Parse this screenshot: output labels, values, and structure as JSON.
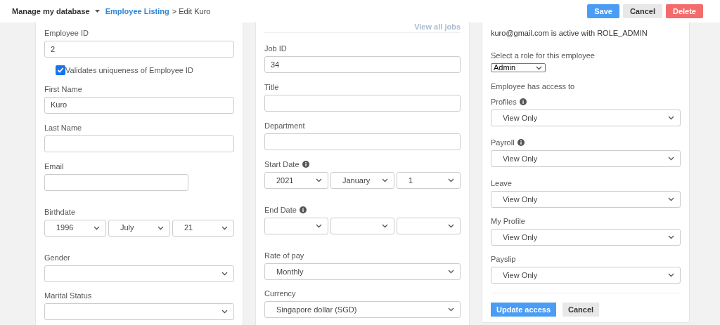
{
  "topbar": {
    "menu": "Manage my database",
    "breadcrumb_link": "Employee Listing",
    "breadcrumb_rest": "> Edit Kuro",
    "buttons": [
      {
        "label": "Save",
        "kind": "primary"
      },
      {
        "label": "Cancel",
        "kind": "plain"
      },
      {
        "label": "Delete",
        "kind": "danger"
      }
    ]
  },
  "cards": [
    {
      "fields": [
        {
          "kind": "text",
          "label": "Employee ID",
          "value": "2"
        },
        {
          "kind": "checkbox",
          "label": "Validates uniqueness of Employee ID",
          "checked": true
        },
        {
          "kind": "text",
          "label": "First Name",
          "value": "Kuro"
        },
        {
          "kind": "text",
          "label": "Last Name"
        },
        {
          "kind": "short_text",
          "label": "Email"
        },
        {
          "kind": "date",
          "label": "Birthdate",
          "parts": [
            {
              "value": "1996"
            },
            {
              "value": "July"
            },
            {
              "value": "21"
            }
          ]
        },
        {
          "kind": "select",
          "label": "Gender"
        },
        {
          "kind": "select",
          "label": "Marital Status"
        }
      ]
    },
    {
      "link": "View all jobs",
      "fields": [
        {
          "kind": "text",
          "label": "Job ID",
          "value": "34"
        },
        {
          "kind": "text",
          "label": "Title"
        },
        {
          "kind": "text",
          "label": "Department"
        },
        {
          "kind": "date",
          "label": "Start Date",
          "info": true,
          "parts": [
            {
              "value": "2021"
            },
            {
              "value": "January"
            },
            {
              "value": "1"
            }
          ]
        },
        {
          "kind": "date",
          "label": "End Date",
          "info": true
        },
        {
          "kind": "select",
          "label": "Rate of pay",
          "value": "Monthly"
        },
        {
          "kind": "select",
          "label": "Currency",
          "value": "Singapore dollar (SGD)"
        }
      ]
    },
    {
      "fields": [
        {
          "kind": "note",
          "label": "kuro@gmail.com is active with ROLE_ADMIN"
        },
        {
          "kind": "small_select",
          "label": "Select a role for this employee",
          "value": "Admin"
        },
        {
          "kind": "heading",
          "label": "Employee has access to"
        },
        {
          "kind": "select",
          "label": "Profiles",
          "info": true,
          "value": "View Only"
        },
        {
          "kind": "select",
          "label": "Payroll",
          "info": true,
          "value": "View Only"
        },
        {
          "kind": "select",
          "label": "Leave",
          "value": "View Only"
        },
        {
          "kind": "select",
          "label": "My Profile",
          "value": "View Only"
        },
        {
          "kind": "select",
          "label": "Payslip",
          "value": "View Only"
        },
        {
          "kind": "actions",
          "buttons": [
            {
              "label": "Update access",
              "kind": "primary"
            },
            {
              "label": "Cancel",
              "kind": "plain"
            }
          ]
        }
      ]
    }
  ]
}
